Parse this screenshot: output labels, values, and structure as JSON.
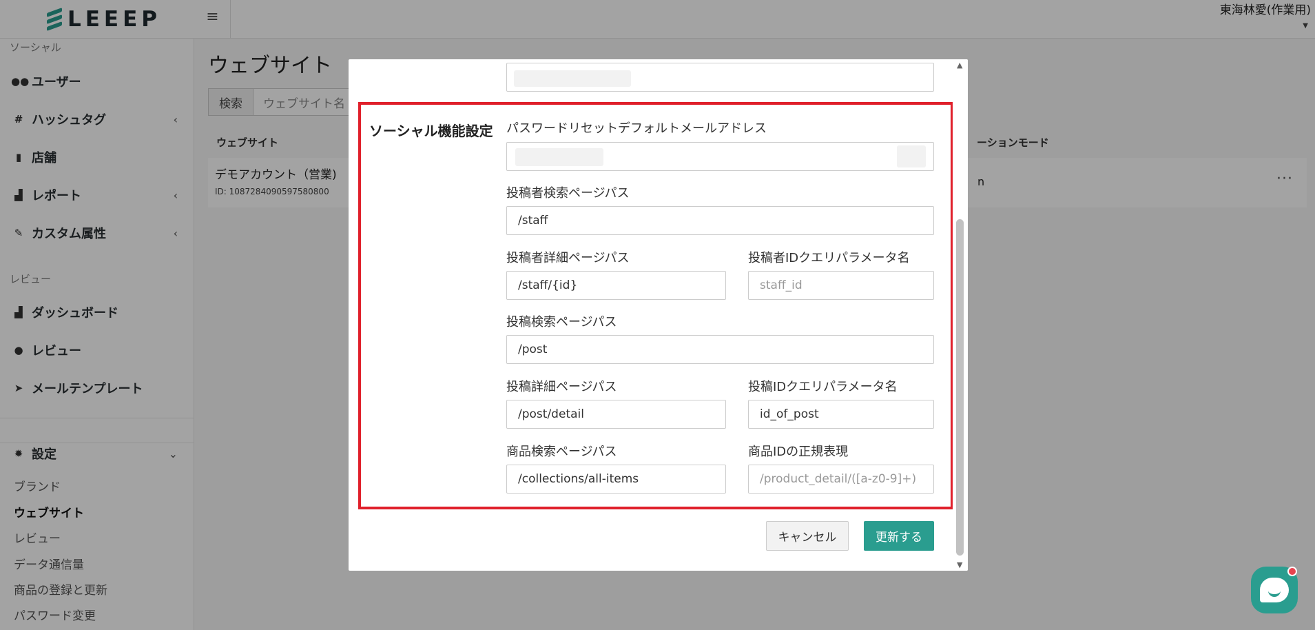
{
  "header": {
    "logo_text": "LEEEP",
    "user_name": "東海林愛(作業用)"
  },
  "sidebar": {
    "section_social": "ソーシャル",
    "items_social": [
      {
        "label": "ユーザー",
        "icon": "users-icon"
      },
      {
        "label": "ハッシュタグ",
        "icon": "hash-icon"
      },
      {
        "label": "店舗",
        "icon": "building-icon"
      },
      {
        "label": "レポート",
        "icon": "bar-chart-icon"
      },
      {
        "label": "カスタム属性",
        "icon": "wrench-icon"
      }
    ],
    "section_review": "レビュー",
    "items_review": [
      {
        "label": "ダッシュボード",
        "icon": "bar-chart-icon"
      },
      {
        "label": "レビュー",
        "icon": "comments-icon"
      },
      {
        "label": "メールテンプレート",
        "icon": "paper-plane-icon"
      }
    ],
    "settings_label": "設定",
    "settings_sub": [
      "ブランド",
      "ウェブサイト",
      "レビュー",
      "データ通信量",
      "商品の登録と更新",
      "パスワード変更"
    ]
  },
  "main": {
    "title": "ウェブサイト",
    "search_button": "検索",
    "search_placeholder": "ウェブサイト名",
    "col_website": "ウェブサイト",
    "col_mode": "ーションモード",
    "row": {
      "name": "デモアカウント（営業)",
      "id": "ID: 1087284090597580800",
      "mode": "n"
    }
  },
  "modal": {
    "section_title": "ソーシャル機能設定",
    "password_reset_label": "パスワードリセットデフォルトメールアドレス",
    "poster_search_label": "投稿者検索ページパス",
    "poster_search_value": "/staff",
    "poster_detail_label": "投稿者詳細ページパス",
    "poster_detail_value": "/staff/{id}",
    "poster_id_label": "投稿者IDクエリパラメータ名",
    "poster_id_placeholder": "staff_id",
    "post_search_label": "投稿検索ページパス",
    "post_search_value": "/post",
    "post_detail_label": "投稿詳細ページパス",
    "post_detail_value": "/post/detail",
    "post_id_label": "投稿IDクエリパラメータ名",
    "post_id_value": "id_of_post",
    "product_search_label": "商品検索ページパス",
    "product_search_value": "/collections/all-items",
    "product_regex_label": "商品IDの正規表現",
    "product_regex_placeholder": "/product_detail/([a-z0-9]+)",
    "cancel_label": "キャンセル",
    "update_label": "更新する"
  },
  "colors": {
    "accent": "#2a9d8f",
    "highlight": "#e0202b"
  }
}
